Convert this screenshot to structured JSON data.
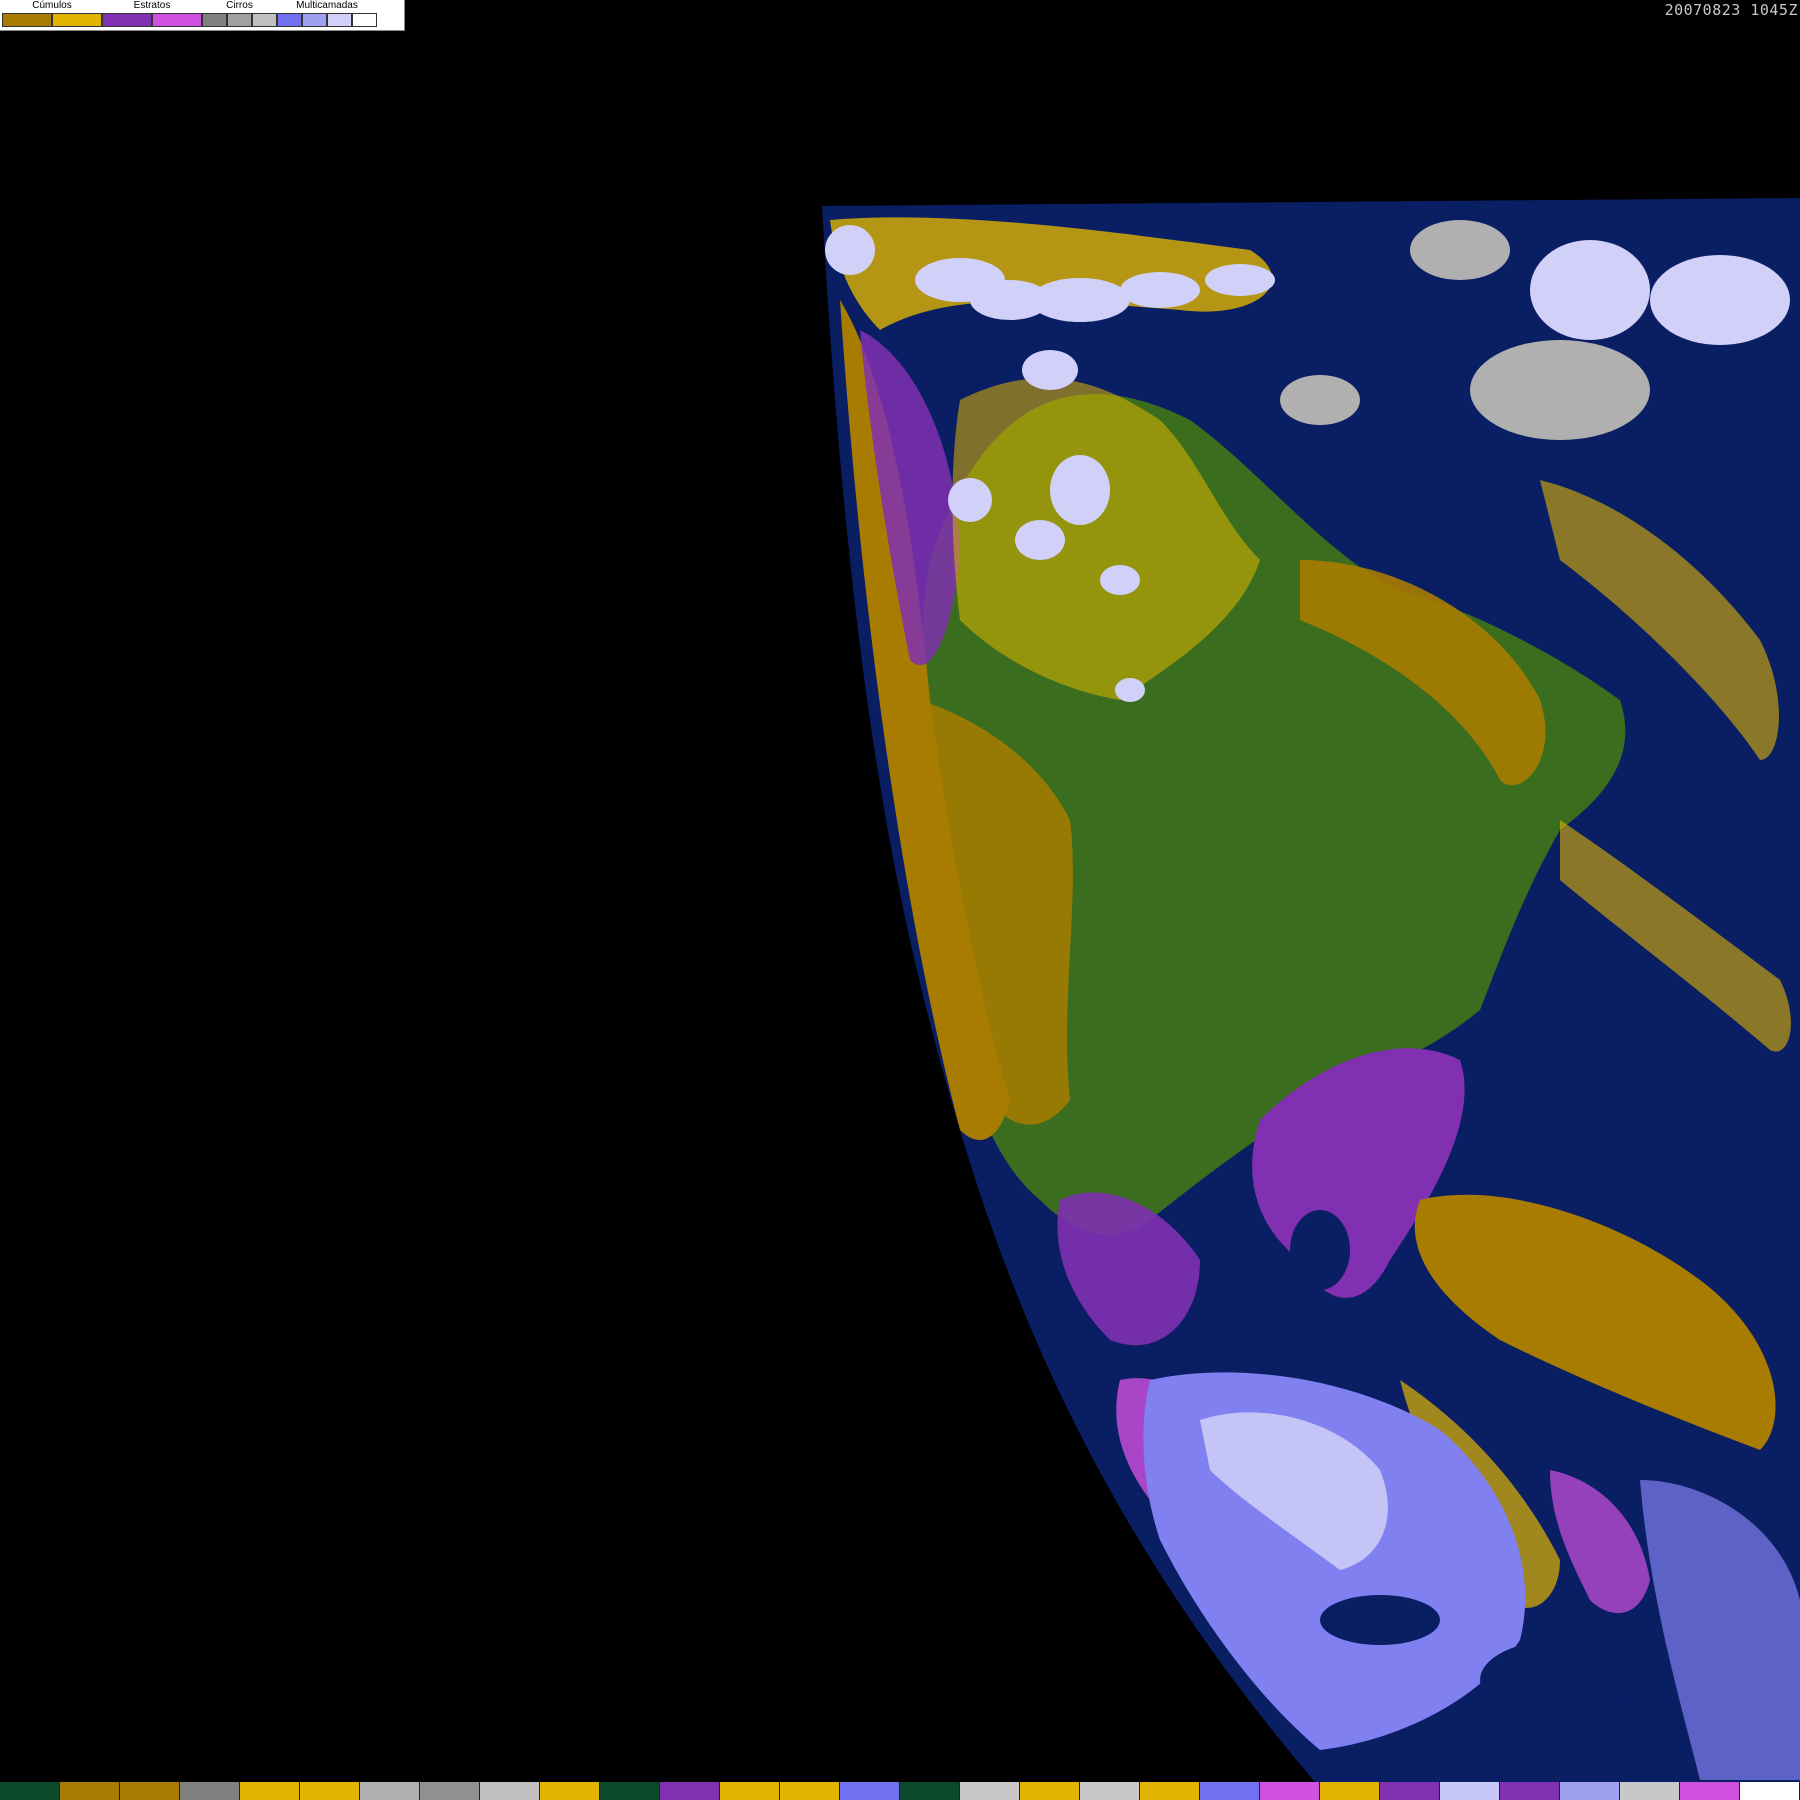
{
  "legend": {
    "groups": [
      {
        "label": "Cúmulos",
        "colors": [
          "#a87c00",
          "#e0b400"
        ]
      },
      {
        "label": "Estratos",
        "colors": [
          "#8030b0",
          "#d050e0"
        ]
      },
      {
        "label": "Cirros",
        "colors": [
          "#808080",
          "#a0a0a0",
          "#c0c0c0"
        ]
      },
      {
        "label": "Multicamadas",
        "colors": [
          "#7070f0",
          "#a0a0f0",
          "#d0d0f8",
          "#ffffff"
        ]
      }
    ]
  },
  "timestamp": "20070823 1045Z",
  "map_colors": {
    "background": "#000000",
    "ocean": "#0a1e64",
    "land": "#3a6e1e",
    "cumulus_dark": "#a87c00",
    "cumulus_light": "#e0b400",
    "stratus_dark": "#8030b0",
    "stratus_light": "#d050e0",
    "cirrus": "#b0b0b0",
    "multilayer": "#8080f0",
    "multilayer_light": "#d0d0f8"
  },
  "palette_strip": [
    "#0a4a2a",
    "#a87c00",
    "#a87c00",
    "#808080",
    "#e0b400",
    "#e0b400",
    "#b0b0b0",
    "#909090",
    "#c0c0c0",
    "#e0b400",
    "#0a4a2a",
    "#8030b0",
    "#e0b400",
    "#e0b400",
    "#7070f0",
    "#0a4a2a",
    "#c8c8c8",
    "#e0b400",
    "#c8c8c8",
    "#e0b400",
    "#7070f0",
    "#d050e0",
    "#e0b400",
    "#8030b0",
    "#c8c8f8",
    "#8030b0",
    "#a0a0f0",
    "#c8c8c8",
    "#d050e0",
    "#ffffff"
  ]
}
